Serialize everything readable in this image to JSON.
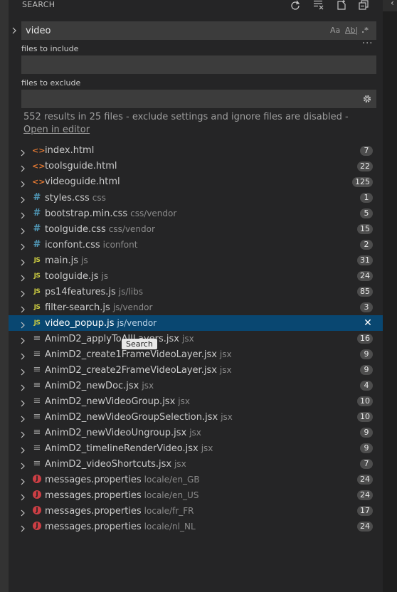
{
  "panel": {
    "title": "SEARCH",
    "header_icons": [
      "refresh-icon",
      "clear-results-icon",
      "new-search-editor-icon",
      "collapse-all-icon"
    ]
  },
  "search": {
    "value": "video",
    "options": {
      "match_case": "Aa",
      "whole_word": "Ab|",
      "regex": ".*"
    },
    "toggle_details": "···"
  },
  "include": {
    "label": "files to include",
    "value": ""
  },
  "exclude": {
    "label": "files to exclude",
    "value": ""
  },
  "summary": {
    "text": "552 results in 25 files - exclude settings and ignore files are disabled - ",
    "link": "Open in editor"
  },
  "tooltip": {
    "text": "Search"
  },
  "files": [
    {
      "name": "index.html",
      "path": "",
      "count": "7",
      "icon": "html"
    },
    {
      "name": "toolsguide.html",
      "path": "",
      "count": "22",
      "icon": "html"
    },
    {
      "name": "videoguide.html",
      "path": "",
      "count": "125",
      "icon": "html"
    },
    {
      "name": "styles.css",
      "path": "css",
      "count": "1",
      "icon": "css"
    },
    {
      "name": "bootstrap.min.css",
      "path": "css/vendor",
      "count": "5",
      "icon": "css"
    },
    {
      "name": "toolguide.css",
      "path": "css/vendor",
      "count": "15",
      "icon": "css"
    },
    {
      "name": "iconfont.css",
      "path": "iconfont",
      "count": "2",
      "icon": "css"
    },
    {
      "name": "main.js",
      "path": "js",
      "count": "31",
      "icon": "js"
    },
    {
      "name": "toolguide.js",
      "path": "js",
      "count": "24",
      "icon": "js"
    },
    {
      "name": "ps14features.js",
      "path": "js/libs",
      "count": "85",
      "icon": "js"
    },
    {
      "name": "filter-search.js",
      "path": "js/vendor",
      "count": "3",
      "icon": "js"
    },
    {
      "name": "video_popup.js",
      "path": "js/vendor",
      "count": "",
      "icon": "js",
      "selected": true
    },
    {
      "name": "AnimD2_applyToAllLayers.jsx",
      "path": "jsx",
      "count": "16",
      "icon": "jsx"
    },
    {
      "name": "AnimD2_create1FrameVideoLayer.jsx",
      "path": "jsx",
      "count": "9",
      "icon": "jsx"
    },
    {
      "name": "AnimD2_create2FrameVideoLayer.jsx",
      "path": "jsx",
      "count": "9",
      "icon": "jsx"
    },
    {
      "name": "AnimD2_newDoc.jsx",
      "path": "jsx",
      "count": "4",
      "icon": "jsx"
    },
    {
      "name": "AnimD2_newVideoGroup.jsx",
      "path": "jsx",
      "count": "10",
      "icon": "jsx"
    },
    {
      "name": "AnimD2_newVideoGroupSelection.jsx",
      "path": "jsx",
      "count": "10",
      "icon": "jsx"
    },
    {
      "name": "AnimD2_newVideoUngroup.jsx",
      "path": "jsx",
      "count": "9",
      "icon": "jsx"
    },
    {
      "name": "AnimD2_timelineRenderVideo.jsx",
      "path": "jsx",
      "count": "9",
      "icon": "jsx"
    },
    {
      "name": "AnimD2_videoShortcuts.jsx",
      "path": "jsx",
      "count": "7",
      "icon": "jsx"
    },
    {
      "name": "messages.properties",
      "path": "locale/en_GB",
      "count": "24",
      "icon": "properties"
    },
    {
      "name": "messages.properties",
      "path": "locale/en_US",
      "count": "24",
      "icon": "properties"
    },
    {
      "name": "messages.properties",
      "path": "locale/fr_FR",
      "count": "17",
      "icon": "properties"
    },
    {
      "name": "messages.properties",
      "path": "locale/nl_NL",
      "count": "24",
      "icon": "properties"
    }
  ],
  "colors": {
    "panel_bg": "#252526",
    "input_bg": "#3c3c3c",
    "selection_bg": "#094771",
    "badge_bg": "#4d4d4d",
    "html_icon": "#e37933",
    "css_icon": "#519aba",
    "js_icon": "#cbcb41",
    "properties_icon": "#cc3e44"
  }
}
